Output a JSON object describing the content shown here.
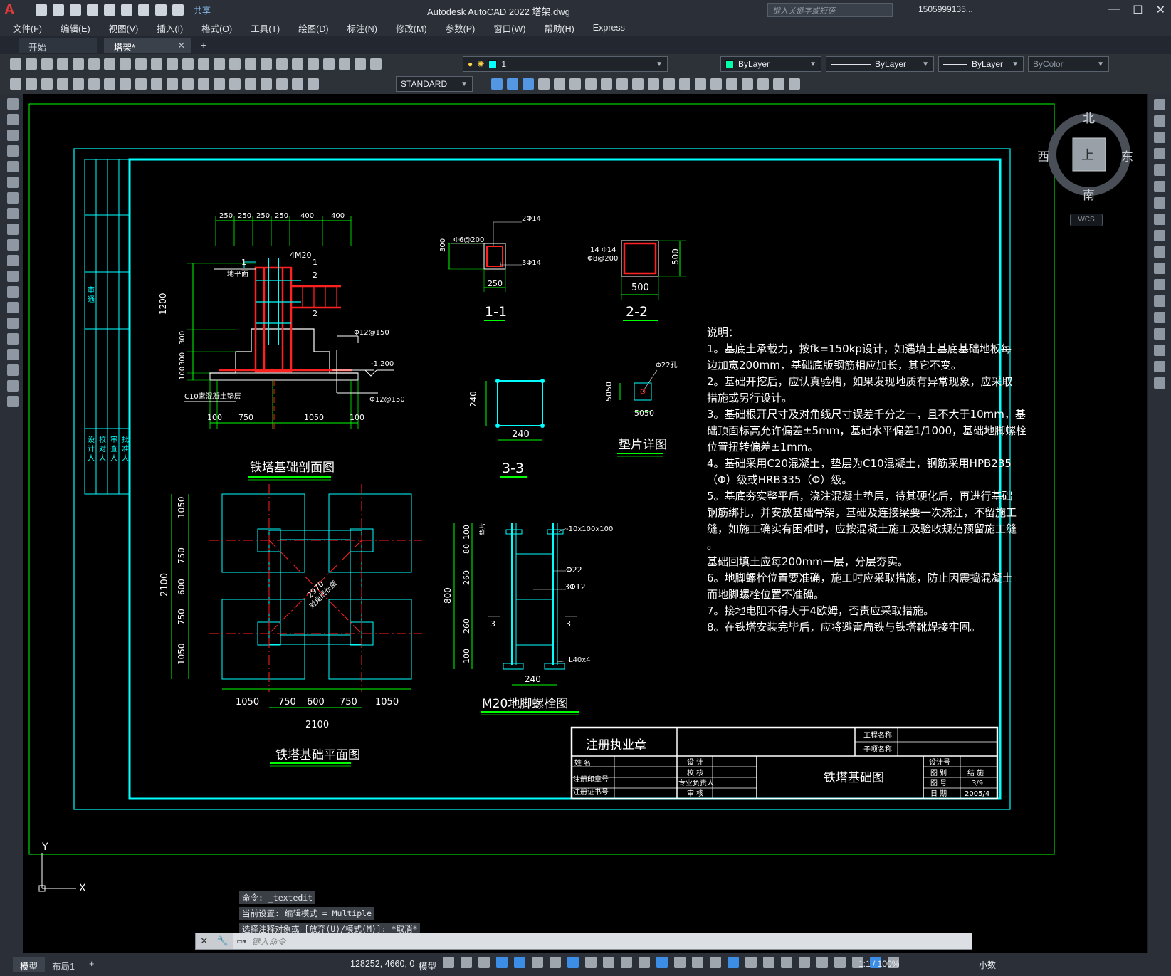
{
  "app": {
    "title": "Autodesk AutoCAD 2022    塔架.dwg",
    "logo": "A",
    "share_label": "共享",
    "search_placeholder": "键入关键字或短语",
    "user": "1505999135...",
    "help": "?"
  },
  "menu": [
    "文件(F)",
    "编辑(E)",
    "视图(V)",
    "插入(I)",
    "格式(O)",
    "工具(T)",
    "绘图(D)",
    "标注(N)",
    "修改(M)",
    "参数(P)",
    "窗口(W)",
    "帮助(H)",
    "Express"
  ],
  "tabs": {
    "start": "开始",
    "active": "塔架*",
    "close": "✕",
    "add": "+"
  },
  "layer_dropdown": {
    "value": "1",
    "color": "#00ffff"
  },
  "properties": {
    "color": "ByLayer",
    "linetype": "ByLayer",
    "lineweight": "ByLayer",
    "plotstyle": "ByColor"
  },
  "text_style": "STANDARD",
  "viewcube": {
    "north": "北",
    "south": "南",
    "east": "东",
    "west": "西",
    "face": "上",
    "wcs": "WCS"
  },
  "ucs": {
    "x": "X",
    "y": "Y"
  },
  "drawing": {
    "left_strip": [
      "审 通",
      "设 计 人",
      "校 对 人",
      "审 查 人",
      "批 准 人"
    ],
    "section_title": "铁塔基础剖面图",
    "section_dims_top": [
      "250",
      "250",
      "250",
      "250",
      "400",
      "400"
    ],
    "section_labels": [
      "4M20",
      "1",
      "1",
      "2",
      "2",
      "地平面",
      "Φ12@150",
      "-1.200",
      "Φ12@150",
      "C10素混凝土垫层"
    ],
    "section_dims_left": [
      "1200",
      "300",
      "300",
      "100"
    ],
    "section_dims_bottom": [
      "100",
      "750",
      "1050",
      "100"
    ],
    "s11": {
      "title": "1-1",
      "labels": [
        "2Φ14",
        "Φ6@200",
        "300",
        "3Φ14",
        "250"
      ]
    },
    "s22": {
      "title": "2-2",
      "labels": [
        "14 Φ14",
        "Φ8@200",
        "500",
        "500"
      ]
    },
    "s33": {
      "title": "3-3",
      "labels": [
        "240",
        "240"
      ]
    },
    "pad": {
      "title": "垫片详图",
      "labels": [
        "Φ22孔",
        "5050",
        "5050"
      ]
    },
    "plan_title": "铁塔基础平面图",
    "plan_dims_left": [
      "1050",
      "750",
      "600",
      "750",
      "1050",
      "2100"
    ],
    "plan_dims_bottom": [
      "1050",
      "750",
      "600",
      "750",
      "1050",
      "2100"
    ],
    "plan_diag": [
      "2970",
      "对角线长度"
    ],
    "bolt": {
      "title": "M20地脚螺栓图",
      "labels": [
        "-10x100x100",
        "Φ22",
        "3Φ12",
        "3",
        "3",
        "L40x4",
        "800",
        "100",
        "80",
        "260",
        "260",
        "100",
        "240",
        "垫片"
      ]
    },
    "notes": [
      "说明：",
      "1。基底土承载力，按fk=150kp设计，如遇填土基底基础地板每",
      "边加宽200mm，基础底版钢筋相应加长，其它不变。",
      "2。基础开挖后，应认真验槽，如果发现地质有异常现象，应采取",
      "措施或另行设计。",
      "3。基础根开尺寸及对角线尺寸误差千分之一，且不大于10mm，基",
      "础顶面标高允许偏差±5mm，基础水平偏差1/1000，基础地脚螺栓",
      "位置扭转偏差±1mm。",
      "4。基础采用C20混凝土，垫层为C10混凝土，钢筋采用HPB235",
      "（Φ）级或HRB335（Φ）级。",
      "5。基底夯实整平后，浇注混凝土垫层，待其硬化后，再进行基础",
      "钢筋绑扎，并安放基础骨架，基础及连接梁要一次浇注，不留施工",
      "缝，如施工确实有困难时，应按混凝土施工及验收规范预留施工缝",
      "。",
      "基础回填土应每200mm一层，分层夯实。",
      "6。地脚螺栓位置要准确，施工时应采取措施，防止因震捣混凝土",
      "而地脚螺栓位置不准确。",
      "7。接地电阻不得大于4欧姆，否责应采取措施。",
      "8。在铁塔安装完毕后，应将避雷扁铁与铁塔靴焊接牢固。"
    ],
    "titleblock": {
      "stamp": "注册执业章",
      "name": "姓  名",
      "seal_no": "注册印章号",
      "cert_no": "注册证书号",
      "design": "设 计",
      "check": "校 核",
      "pro_lead": "专业负责人",
      "review": "审 核",
      "project_name": "工程名称",
      "sub_name": "子项名称",
      "drawing_title": "铁塔基础图",
      "design_no": "设计号",
      "drawing_type_k": "图 别",
      "drawing_type_v": "结 施",
      "drawing_no_k": "图 号",
      "drawing_no_v": "3/9",
      "date_k": "日 期",
      "date_v": "2005/4"
    }
  },
  "command": {
    "history": [
      "命令: _textedit",
      "当前设置: 编辑模式 = Multiple",
      "选择注释对象或 [放弃(U)/模式(M)]: *取消*"
    ],
    "placeholder": "键入命令"
  },
  "layouts": {
    "model": "模型",
    "layout1": "布局1",
    "add": "+"
  },
  "status": {
    "coords": "128252, 4660, 0",
    "model": "模型",
    "scale": "1:1 / 100%",
    "units": "小数"
  }
}
